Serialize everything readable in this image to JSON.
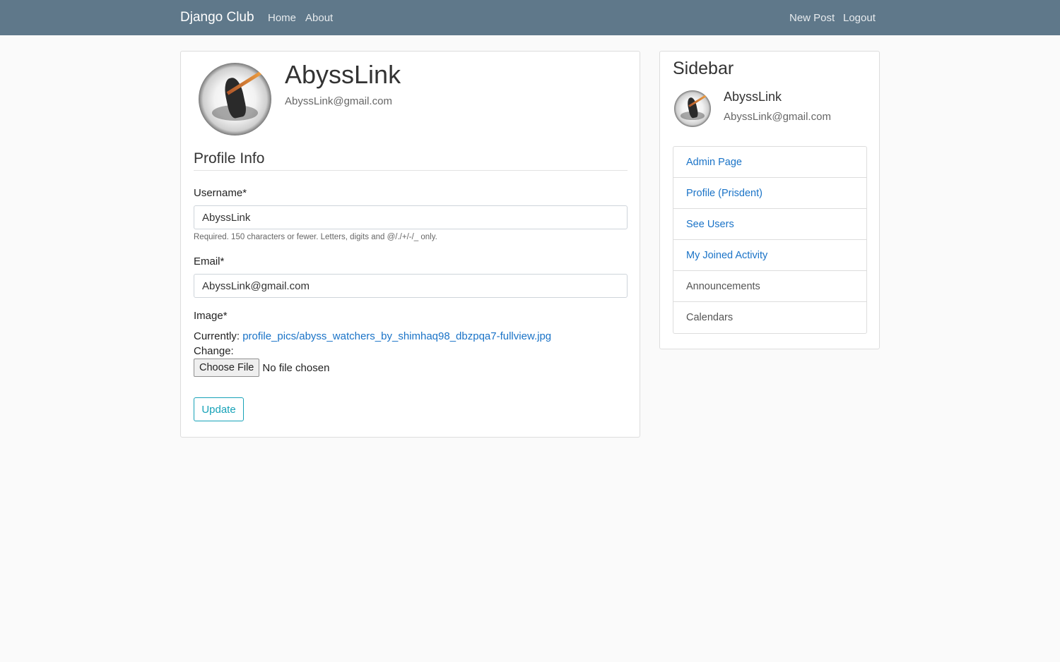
{
  "navbar": {
    "brand": "Django Club",
    "left_links": [
      "Home",
      "About"
    ],
    "right_links": [
      "New Post",
      "Logout"
    ],
    "bg_color": "#5f788a"
  },
  "profile": {
    "username": "AbyssLink",
    "email": "AbyssLink@gmail.com",
    "avatar_icon": "profile-avatar"
  },
  "form": {
    "legend": "Profile Info",
    "username_label": "Username*",
    "username_value": "AbyssLink",
    "username_help": "Required. 150 characters or fewer. Letters, digits and @/./+/-/_ only.",
    "email_label": "Email*",
    "email_value": "AbyssLink@gmail.com",
    "image_label": "Image*",
    "currently_label": "Currently:",
    "current_file": "profile_pics/abyss_watchers_by_shimhaq98_dbzpqa7-fullview.jpg",
    "change_label": "Change:",
    "choose_file": "Choose File",
    "no_file": "No file chosen",
    "update_label": "Update"
  },
  "sidebar": {
    "title": "Sidebar",
    "username": "AbyssLink",
    "email": "AbyssLink@gmail.com",
    "items": [
      {
        "label": "Admin Page",
        "link": true
      },
      {
        "label": "Profile (Prisdent)",
        "link": true
      },
      {
        "label": "See Users",
        "link": true
      },
      {
        "label": "My Joined Activity",
        "link": true
      },
      {
        "label": "Announcements",
        "link": false
      },
      {
        "label": "Calendars",
        "link": false
      }
    ]
  }
}
